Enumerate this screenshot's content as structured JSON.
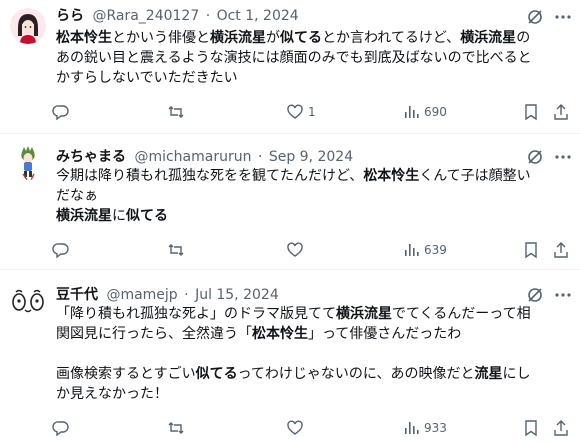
{
  "tweets": [
    {
      "name": "らら",
      "handle": "@Rara_240127",
      "date": "Oct 1, 2024",
      "lines": [
        [
          {
            "t": "松本怜生",
            "b": true
          },
          {
            "t": "とかいう俳優と",
            "b": false
          },
          {
            "t": "横浜流星",
            "b": true
          },
          {
            "t": "が",
            "b": false
          },
          {
            "t": "似てる",
            "b": true
          },
          {
            "t": "とか言われてるけど、",
            "b": false
          },
          {
            "t": "横浜流星",
            "b": true
          },
          {
            "t": "の",
            "b": false
          }
        ],
        [
          {
            "t": "あの鋭い目と震えるような演技には顔面のみでも到底及ばないので比べると",
            "b": false
          }
        ],
        [
          {
            "t": "かすらしないでいただきたい",
            "b": false
          }
        ]
      ],
      "replies": "",
      "reposts": "",
      "likes": "1",
      "views": "690"
    },
    {
      "name": "みちゃまる",
      "handle": "@michamarurun",
      "date": "Sep 9, 2024",
      "lines": [
        [
          {
            "t": "今期は降り積もれ孤独な死をを観てたんだけど、",
            "b": false
          },
          {
            "t": "松本怜生",
            "b": true
          },
          {
            "t": "くんて子は顔整い",
            "b": false
          }
        ],
        [
          {
            "t": "だなぁ",
            "b": false
          }
        ],
        [
          {
            "t": "横浜流星",
            "b": true
          },
          {
            "t": "に",
            "b": false
          },
          {
            "t": "似てる",
            "b": true
          }
        ]
      ],
      "replies": "",
      "reposts": "",
      "likes": "",
      "views": "639"
    },
    {
      "name": "豆千代",
      "handle": "@mamejp",
      "date": "Jul 15, 2024",
      "lines": [
        [
          {
            "t": "「降り積もれ孤独な死よ」のドラマ版見てて",
            "b": false
          },
          {
            "t": "横浜流星",
            "b": true
          },
          {
            "t": "でてくるんだーって相",
            "b": false
          }
        ],
        [
          {
            "t": "関図見に行ったら、全然違う「",
            "b": false
          },
          {
            "t": "松本怜生",
            "b": true
          },
          {
            "t": "」って俳優さんだったわ",
            "b": false
          }
        ],
        [],
        [
          {
            "t": "画像検索するとすごい",
            "b": false
          },
          {
            "t": "似てる",
            "b": true
          },
          {
            "t": "ってわけじゃないのに、あの映像だと",
            "b": false
          },
          {
            "t": "流星",
            "b": true
          },
          {
            "t": "にし",
            "b": false
          }
        ],
        [
          {
            "t": "か見えなかった！",
            "b": false
          }
        ]
      ],
      "replies": "",
      "reposts": "",
      "likes": "",
      "views": "933"
    }
  ],
  "icons": {
    "avatar_1": "avatar-girl-icon",
    "avatar_2": "avatar-chibi-icon",
    "avatar_3": "avatar-mame-icon",
    "grok": "grok-icon",
    "more": "more-icon",
    "reply": "reply-icon",
    "repost": "repost-icon",
    "like": "heart-icon",
    "views": "views-icon",
    "bookmark": "bookmark-icon",
    "share": "share-icon"
  },
  "colors": {
    "text": "#0f1419",
    "secondary": "#536471",
    "divider": "#eff3f4"
  }
}
